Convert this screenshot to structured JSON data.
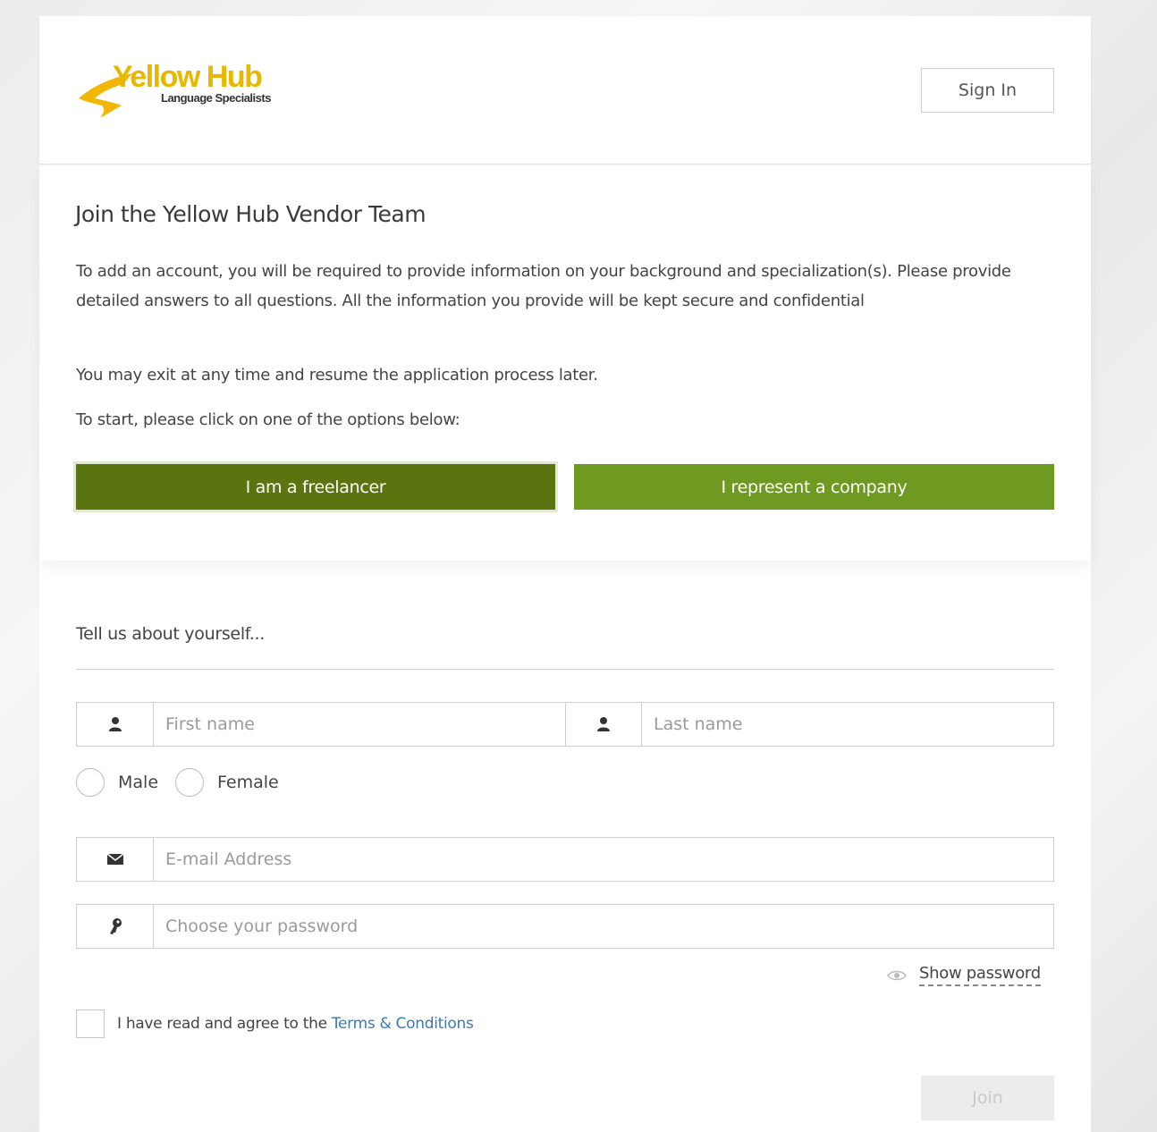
{
  "header": {
    "logo_text": "Yellow Hub",
    "logo_subtext": "Language Specialists",
    "signin_label": "Sign In"
  },
  "intro": {
    "title": "Join the Yellow Hub Vendor Team",
    "paragraph1": "To add an account, you will be required to provide information on your background and specialization(s). Please provide detailed answers to all questions. All the information you provide will be kept secure and confidential",
    "paragraph2": "You may exit at any time and resume the application process later.",
    "paragraph3": "To start, please click on one of the options below:",
    "freelancer_label": "I am a freelancer",
    "company_label": "I represent a company"
  },
  "form": {
    "section_label": "Tell us about yourself...",
    "first_name_placeholder": "First name",
    "last_name_placeholder": "Last name",
    "gender_options": [
      "Male",
      "Female"
    ],
    "email_placeholder": "E-mail Address",
    "password_placeholder": "Choose your password",
    "show_password_label": "Show password",
    "terms_prefix": "I have read and agree to the ",
    "terms_link": "Terms & Conditions",
    "join_label": "Join"
  },
  "colors": {
    "freelancer_button": "#5a7410",
    "company_button": "#6f9a21",
    "logo_yellow": "#e8b800",
    "link_blue": "#3d79b3"
  },
  "icons": [
    "user-icon",
    "envelope-icon",
    "key-icon",
    "eye-icon"
  ]
}
